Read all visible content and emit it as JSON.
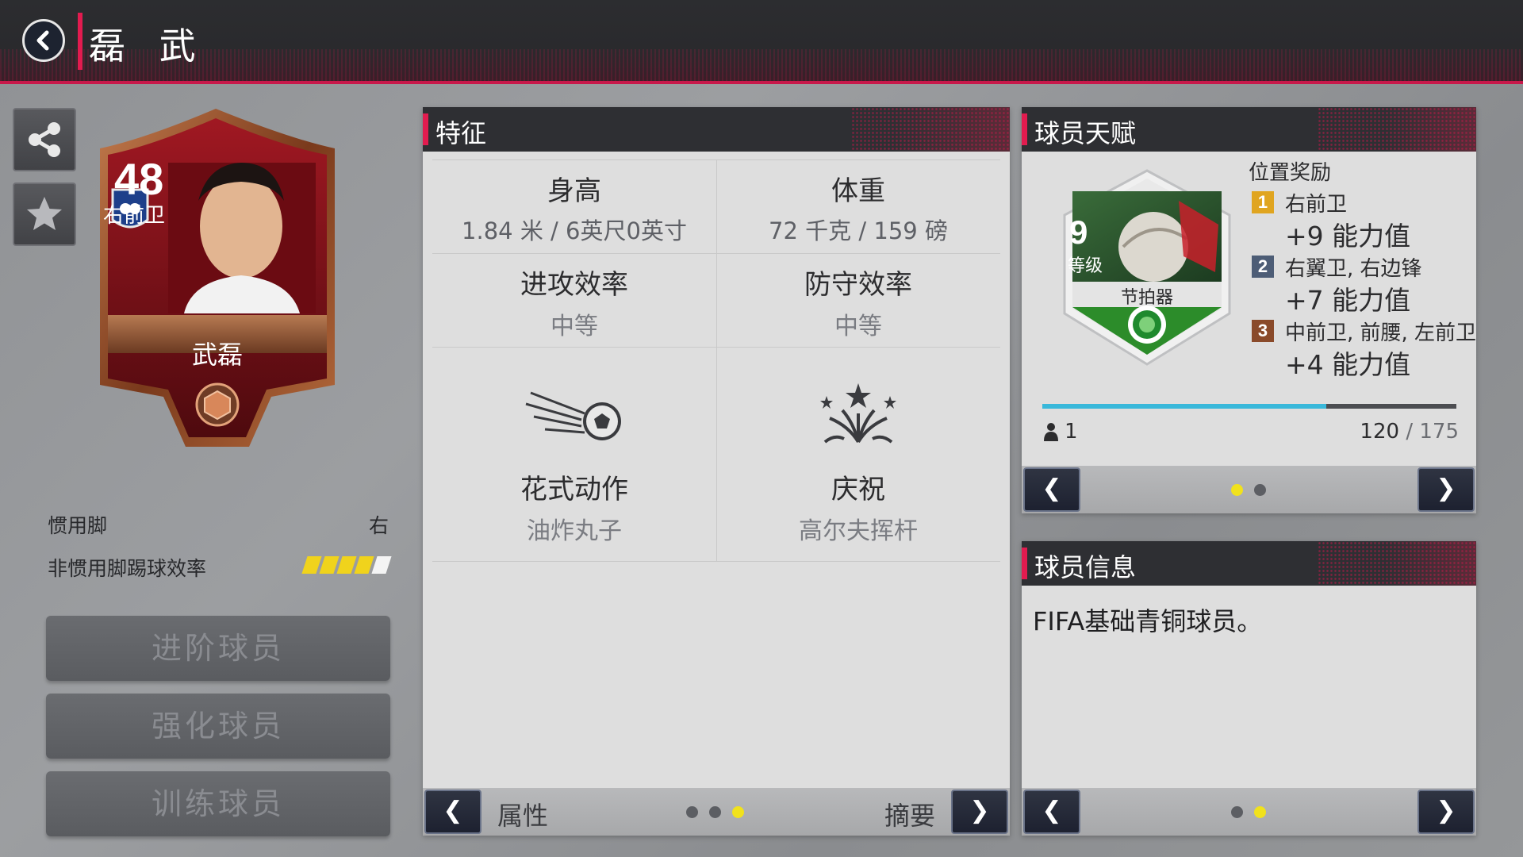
{
  "header": {
    "title": "磊 武",
    "back_icon": "chevron-left-icon"
  },
  "card": {
    "rating": "48",
    "position": "右前卫",
    "name": "武磊",
    "colors": {
      "frame": "#8b3a1e",
      "inner": "#7a0e14",
      "bronze": "#b06a42"
    }
  },
  "profile": {
    "preferred_foot_label": "惯用脚",
    "preferred_foot_value": "右",
    "weak_foot_label": "非惯用脚踢球效率",
    "weak_foot_stars": 4,
    "weak_foot_max": 5
  },
  "actions": {
    "advance": "进阶球员",
    "upgrade": "强化球员",
    "train": "训练球员"
  },
  "features": {
    "title": "特征",
    "height_label": "身高",
    "height_value": "1.84 米 / 6英尺0英寸",
    "weight_label": "体重",
    "weight_value": "72 千克 / 159 磅",
    "attack_label": "进攻效率",
    "attack_value": "中等",
    "defense_label": "防守效率",
    "defense_value": "中等",
    "skill_label": "花式动作",
    "skill_value": "油炸丸子",
    "celebration_label": "庆祝",
    "celebration_value": "高尔夫挥杆",
    "footer_left": "属性",
    "footer_right": "摘要",
    "page_count": 3,
    "page_active": 3
  },
  "talent": {
    "title": "球员天赋",
    "badge_level": "9",
    "badge_level_label": "等级",
    "badge_name": "节拍器",
    "bonus_title": "位置奖励",
    "bonuses": [
      {
        "rank": "1",
        "positions": "右前卫",
        "value": "+9 能力值",
        "color": "#e0a520"
      },
      {
        "rank": "2",
        "positions": "右翼卫, 右边锋",
        "value": "+7 能力值",
        "color": "#4d5d76"
      },
      {
        "rank": "3",
        "positions": "中前卫, 前腰, 左前卫",
        "value": "+4 能力值",
        "color": "#8a4a2a"
      }
    ],
    "owner_count": "1",
    "progress_current": "120",
    "progress_separator": "/",
    "progress_max": "175",
    "progress_fraction": 0.686,
    "page_count": 2,
    "page_active": 1
  },
  "info": {
    "title": "球员信息",
    "text": "FIFA基础青铜球员。",
    "page_count": 2,
    "page_active": 2
  }
}
